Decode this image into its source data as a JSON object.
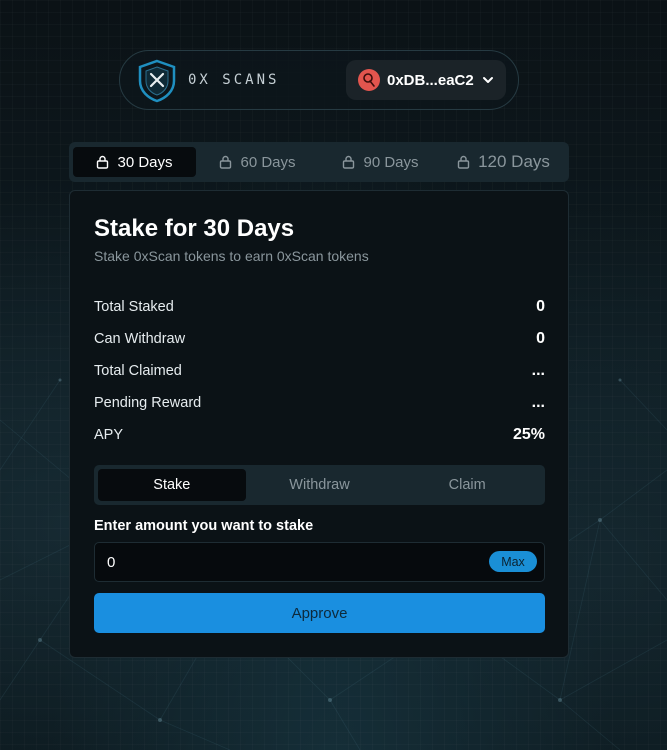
{
  "header": {
    "brand": "0X SCANS",
    "wallet_address": "0xDB...eaC2"
  },
  "period_tabs": [
    {
      "label": "30 Days",
      "active": true
    },
    {
      "label": "60 Days",
      "active": false
    },
    {
      "label": "90 Days",
      "active": false
    },
    {
      "label": "120 Days",
      "active": false
    }
  ],
  "card": {
    "title": "Stake for 30 Days",
    "subtitle": "Stake 0xScan tokens to earn 0xScan tokens",
    "stats": [
      {
        "label": "Total Staked",
        "value": "0"
      },
      {
        "label": "Can Withdraw",
        "value": "0"
      },
      {
        "label": "Total Claimed",
        "value": "..."
      },
      {
        "label": "Pending Reward",
        "value": "..."
      },
      {
        "label": "APY",
        "value": "25%"
      }
    ],
    "action_tabs": [
      {
        "label": "Stake",
        "active": true
      },
      {
        "label": "Withdraw",
        "active": false
      },
      {
        "label": "Claim",
        "active": false
      }
    ],
    "amount_label": "Enter amount you want to stake",
    "amount_value": "0",
    "max_label": "Max",
    "approve_label": "Approve"
  },
  "colors": {
    "accent": "#1a8fe0",
    "background": "#0a1419",
    "card": "#0b1216",
    "tab_bar": "#19282f",
    "wallet_avatar": "#e2554e"
  },
  "icons": {
    "logo": "shield-x-logo",
    "wallet": "wallet-avatar-icon",
    "chevron": "chevron-down-icon",
    "lock": "lock-icon"
  }
}
